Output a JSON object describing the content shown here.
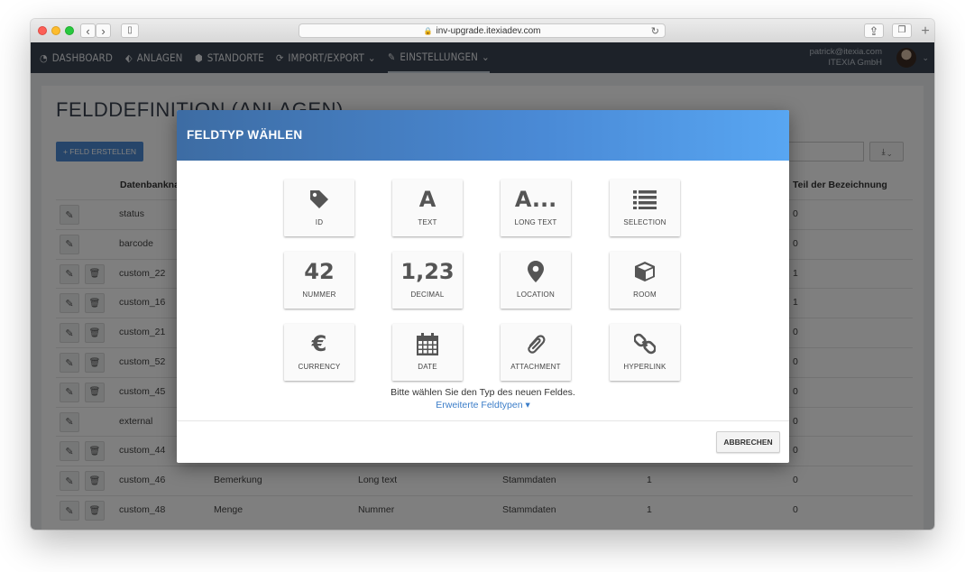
{
  "browser": {
    "url": "inv-upgrade.itexiadev.com",
    "back_glyph": "‹",
    "forward_glyph": "›",
    "sidebar_glyph": "▯",
    "share_glyph": "⇪",
    "tabs_glyph": "❐",
    "plus_glyph": "+",
    "reload_glyph": "↻"
  },
  "navbar": {
    "items": [
      {
        "label": "DASHBOARD",
        "icon": "dashboard-icon",
        "glyph": "◔"
      },
      {
        "label": "ANLAGEN",
        "icon": "tag-icon",
        "glyph": "⬖"
      },
      {
        "label": "STANDORTE",
        "icon": "cube-icon",
        "glyph": "⬢"
      },
      {
        "label": "IMPORT/EXPORT",
        "icon": "sync-icon",
        "glyph": "⟳",
        "caret": "⌄"
      },
      {
        "label": "EINSTELLUNGEN",
        "icon": "wrench-icon",
        "glyph": "✎",
        "caret": "⌄"
      }
    ],
    "user_email": "patrick@itexia.com",
    "company": "ITEXIA GmbH",
    "user_caret": "⌄"
  },
  "page": {
    "title": "FELDDEFINITION (ANLAGEN)",
    "create_button": "+ FELD ERSTELLEN",
    "export_label": "⤓ ⌄",
    "columns": [
      "Datenbankname",
      "Teil der Bezeichnung"
    ],
    "rows": [
      {
        "name": "status",
        "bez": "0",
        "del": false
      },
      {
        "name": "barcode",
        "bez": "0",
        "del": false
      },
      {
        "name": "custom_22",
        "bez": "1",
        "del": true
      },
      {
        "name": "custom_16",
        "bez": "1",
        "del": true
      },
      {
        "name": "custom_21",
        "bez": "0",
        "del": true
      },
      {
        "name": "custom_52",
        "bez": "0",
        "del": true
      },
      {
        "name": "custom_45",
        "bez": "0",
        "del": true
      },
      {
        "name": "external",
        "bez": "0",
        "del": false
      },
      {
        "name": "custom_44",
        "bez": "0",
        "del": true
      },
      {
        "name": "custom_46",
        "label": "Bemerkung",
        "type": "Long text",
        "group": "Stammdaten",
        "num": "1",
        "bez": "0",
        "del": true
      },
      {
        "name": "custom_48",
        "label": "Menge",
        "type": "Nummer",
        "group": "Stammdaten",
        "num": "1",
        "bez": "0",
        "del": true
      }
    ],
    "edit_glyph": "✎",
    "delete_glyph": "🗑"
  },
  "modal": {
    "title": "FELDTYP WÄHLEN",
    "tiles": [
      {
        "label": "ID",
        "icon": "tag-icon",
        "glyph": ""
      },
      {
        "label": "TEXT",
        "icon": "text-icon",
        "glyph": "A"
      },
      {
        "label": "LONG TEXT",
        "icon": "long-text-icon",
        "glyph": "A..."
      },
      {
        "label": "SELECTION",
        "icon": "list-icon",
        "glyph": ""
      },
      {
        "label": "NUMMER",
        "icon": "number-icon",
        "glyph": "42"
      },
      {
        "label": "DECIMAL",
        "icon": "decimal-icon",
        "glyph": "1,23"
      },
      {
        "label": "LOCATION",
        "icon": "map-marker-icon",
        "glyph": ""
      },
      {
        "label": "ROOM",
        "icon": "cube-icon",
        "glyph": ""
      },
      {
        "label": "CURRENCY",
        "icon": "euro-icon",
        "glyph": "€"
      },
      {
        "label": "DATE",
        "icon": "calendar-icon",
        "glyph": ""
      },
      {
        "label": "ATTACHMENT",
        "icon": "paperclip-icon",
        "glyph": ""
      },
      {
        "label": "HYPERLINK",
        "icon": "link-icon",
        "glyph": ""
      }
    ],
    "hint": "Bitte wählen Sie den Typ des neuen Feldes.",
    "advanced_link": "Erweiterte Feldtypen ▾",
    "cancel": "ABBRECHEN"
  }
}
